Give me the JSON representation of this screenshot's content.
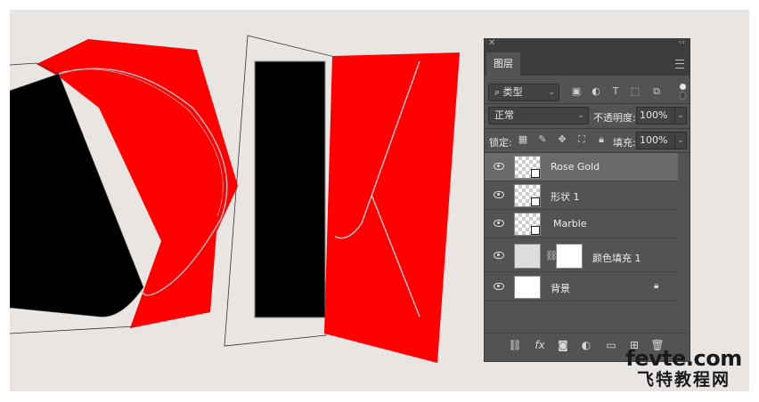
{
  "panel": {
    "tab_label": "图层",
    "filter_kind": "类型",
    "blend_mode": "正常",
    "opacity_label": "不透明度:",
    "opacity_value": "100%",
    "lock_label": "锁定:",
    "fill_label": "填充:",
    "fill_value": "100%"
  },
  "layers": [
    {
      "name": "Rose Gold",
      "selected": true
    },
    {
      "name": "形状 1",
      "selected": false
    },
    {
      "name": "Marble",
      "selected": false
    },
    {
      "name": "颜色填充 1",
      "selected": false
    },
    {
      "name": "背景",
      "selected": false
    }
  ],
  "colors": {
    "canvas_bg": "#e8e5e2",
    "shape_red": "#ff0000",
    "shape_black": "#000000",
    "panel_bg": "#535353"
  },
  "watermark": {
    "domain": "fevte.com",
    "chinese": "飞特教程网"
  }
}
